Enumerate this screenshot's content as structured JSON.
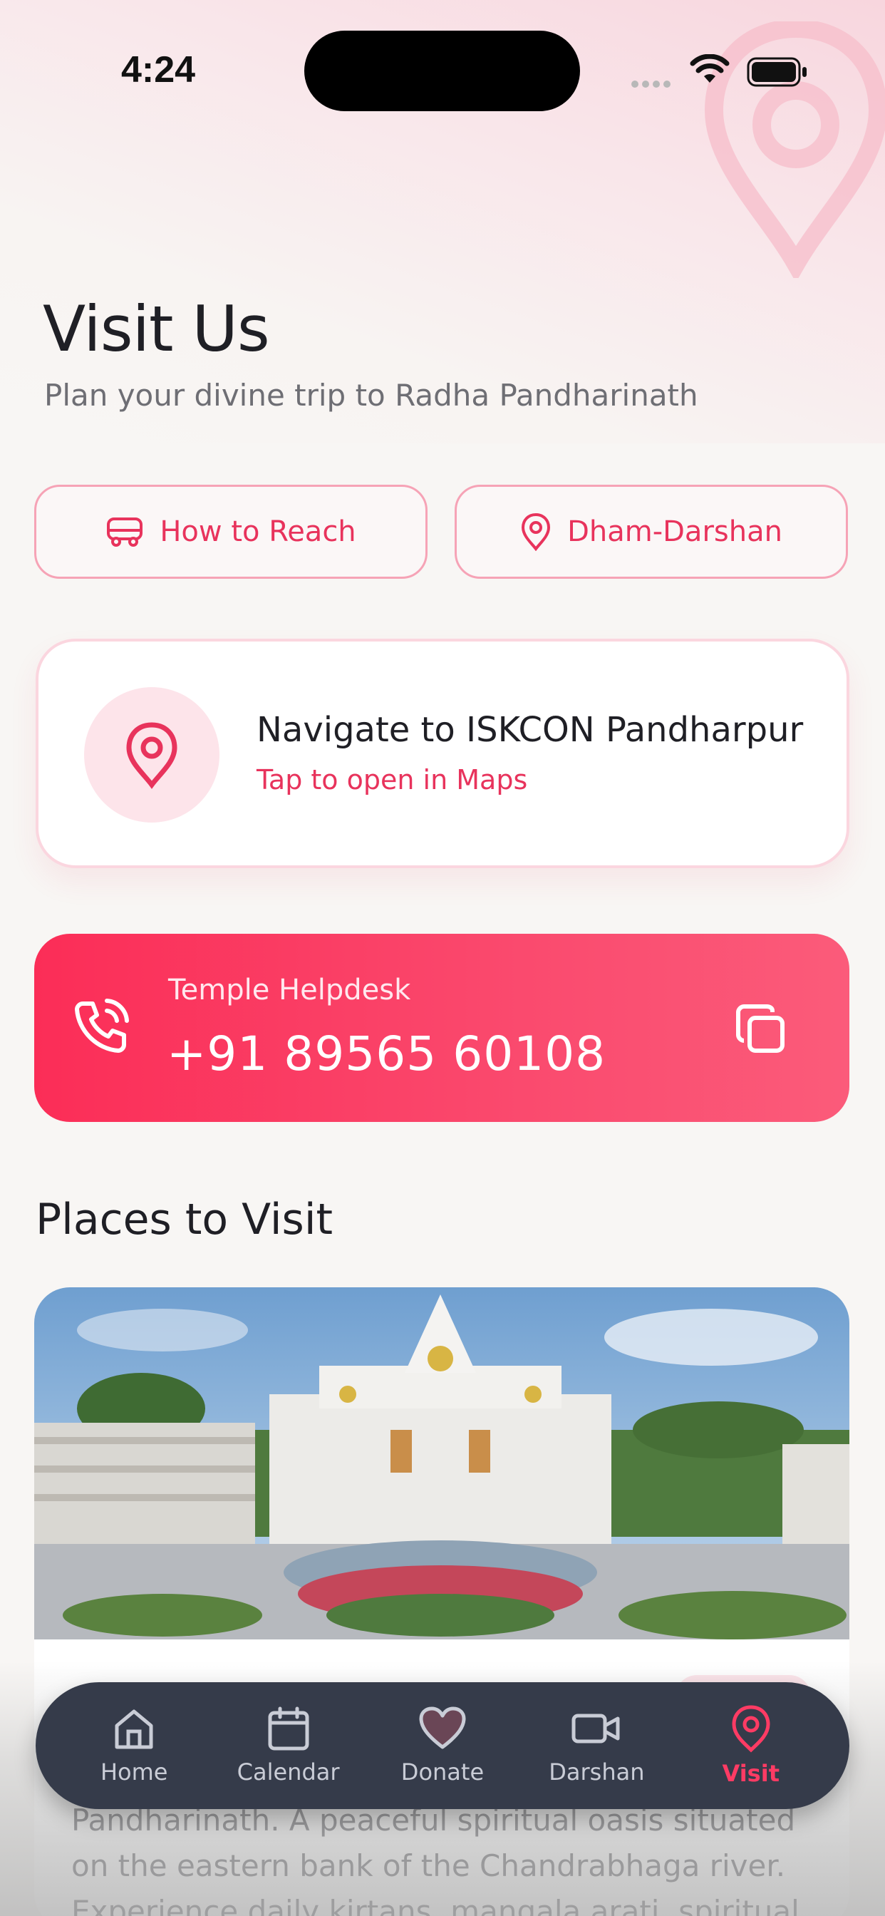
{
  "status_bar": {
    "time": "4:24"
  },
  "header": {
    "title": "Visit Us",
    "subtitle": "Plan your divine trip to Radha Pandharinath"
  },
  "actions": {
    "how_to_reach": "How to Reach",
    "dham_darshan": "Dham-Darshan"
  },
  "navigate_card": {
    "title": "Navigate to ISKCON Pandharpur",
    "subtitle": "Tap to open in Maps"
  },
  "helpdesk": {
    "label": "Temple Helpdesk",
    "phone": "+91 89565 60108"
  },
  "places": {
    "section_title": "Places to Visit",
    "description": "Pandharinath. A peaceful spiritual oasis situated on the eastern bank of the Chandrabhaga river. Experience daily kirtans, mangala arati, spiritual"
  },
  "tab_bar": {
    "items": [
      {
        "label": "Home",
        "icon": "home-icon"
      },
      {
        "label": "Calendar",
        "icon": "calendar-icon"
      },
      {
        "label": "Donate",
        "icon": "heart-icon"
      },
      {
        "label": "Darshan",
        "icon": "video-icon"
      },
      {
        "label": "Visit",
        "icon": "location-pin-icon",
        "active": true
      }
    ]
  },
  "colors": {
    "accent": "#e8335c",
    "accent_gradient_start": "#fb2d57",
    "tab_bar_bg": "#353b4a",
    "background": "#f8f6f4"
  }
}
